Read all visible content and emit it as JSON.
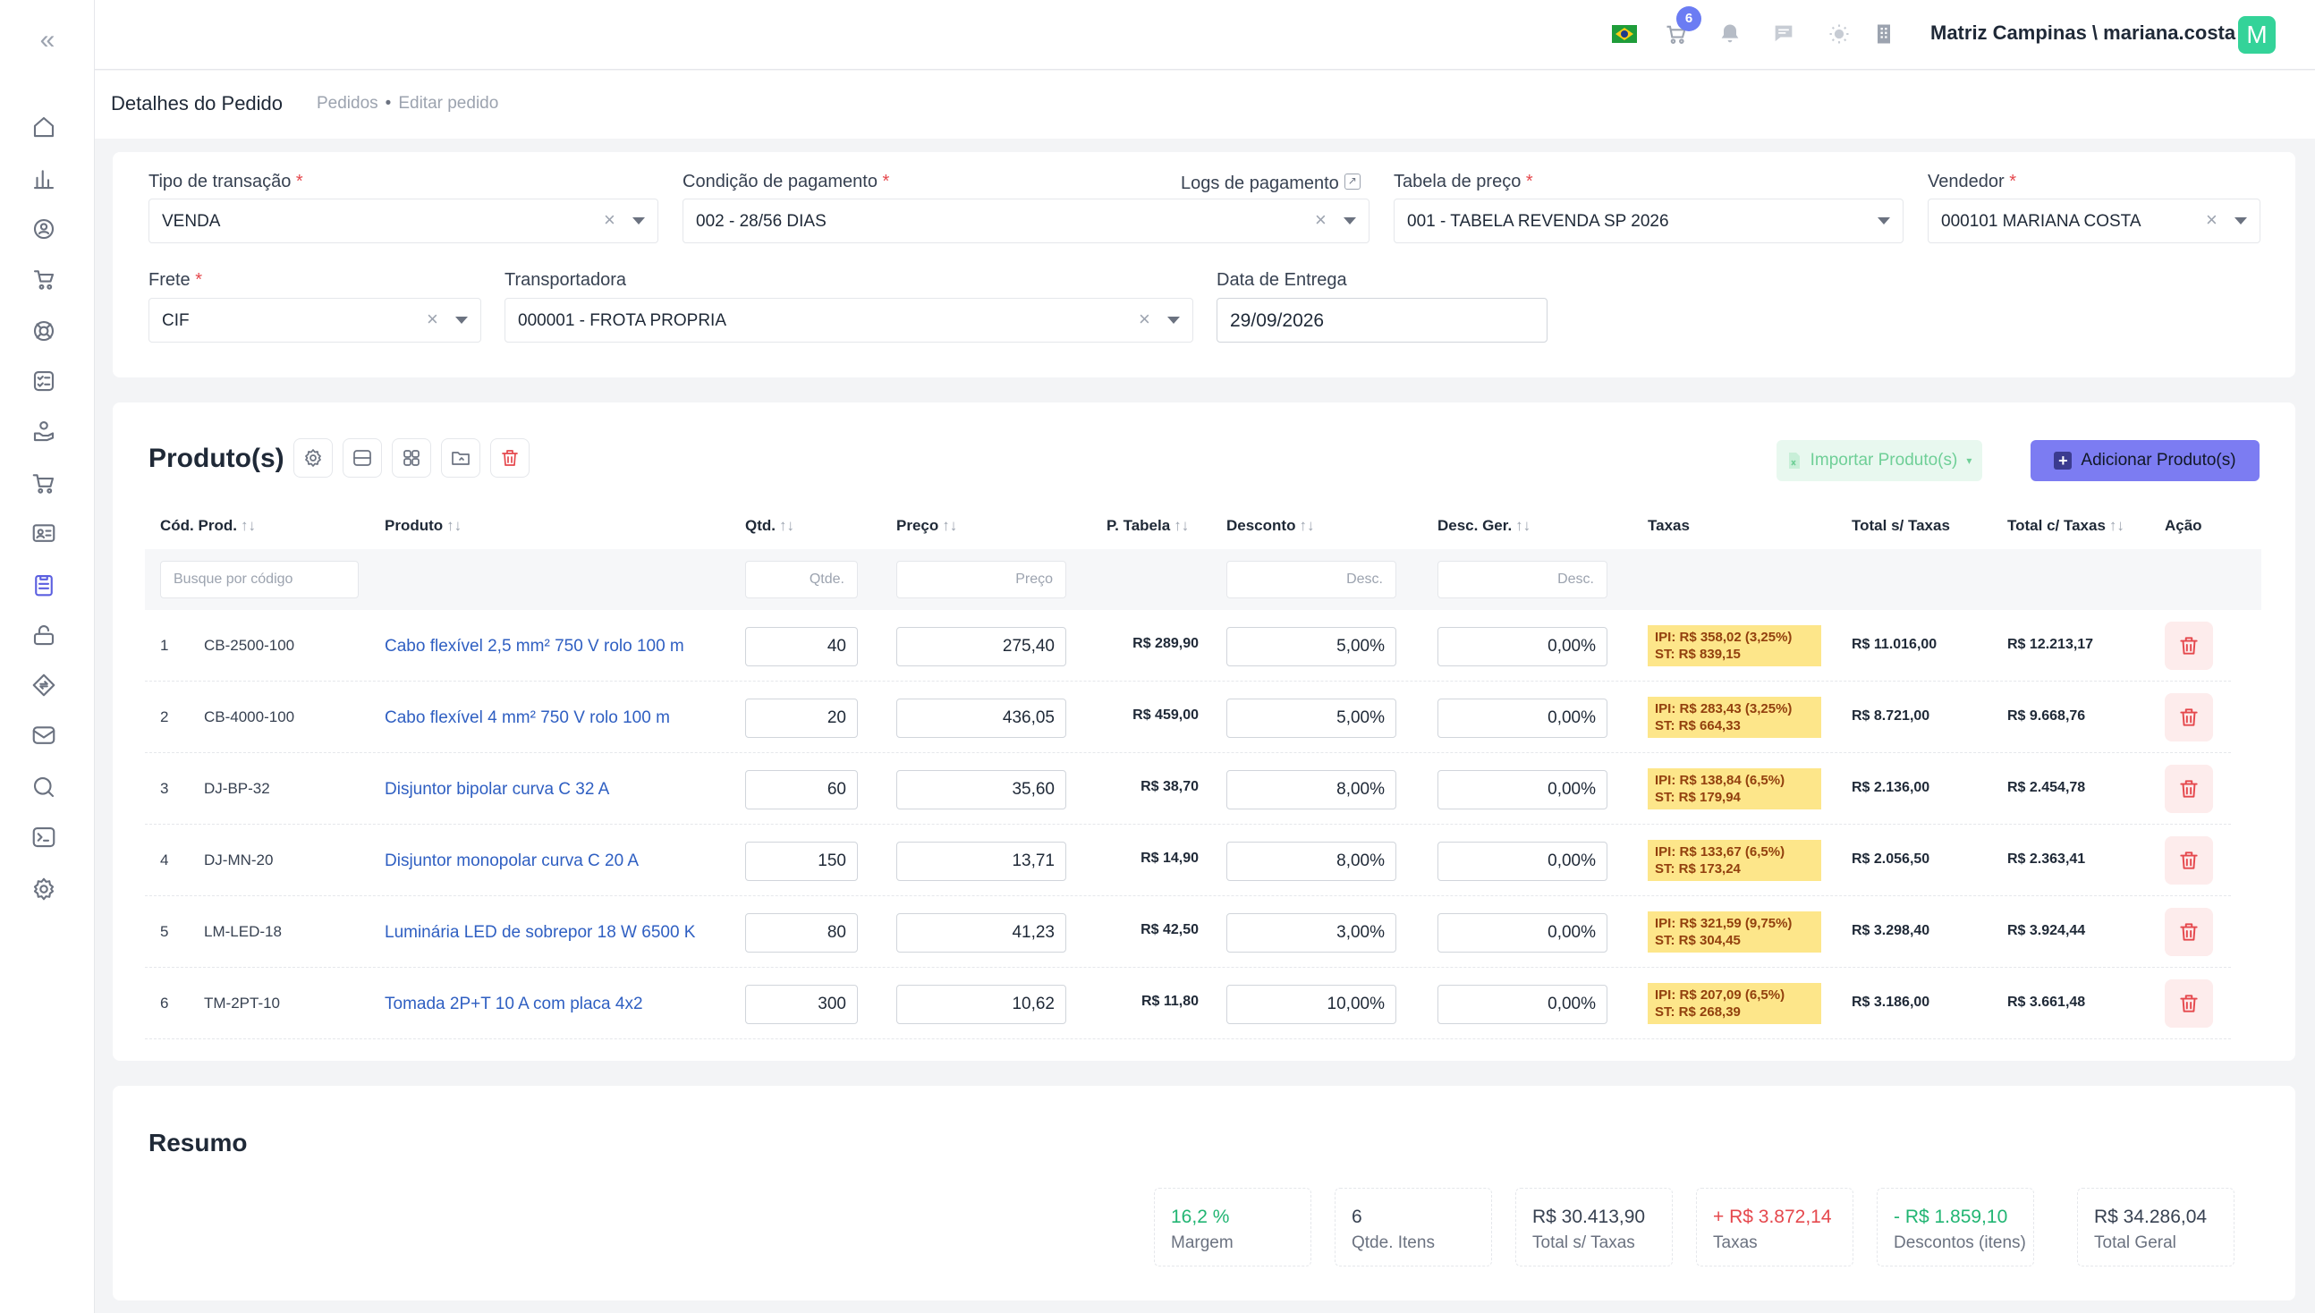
{
  "header": {
    "cart_count": "6",
    "user": "Matriz Campinas \\ mariana.costa",
    "avatar_letter": "M"
  },
  "breadcrumb": {
    "title": "Detalhes do Pedido",
    "items": [
      "Pedidos",
      "Editar pedido"
    ]
  },
  "form": {
    "tipo_label": "Tipo de transação",
    "tipo_value": "VENDA",
    "condicao_label": "Condição de pagamento",
    "condicao_value": "002 - 28/56 DIAS",
    "logs_label": "Logs de pagamento",
    "tabela_label": "Tabela de preço",
    "tabela_value": "001 - TABELA REVENDA SP 2026",
    "vendedor_label": "Vendedor",
    "vendedor_value": "000101 MARIANA COSTA",
    "frete_label": "Frete",
    "frete_value": "CIF",
    "transportadora_label": "Transportadora",
    "transportadora_value": "000001 - FROTA PROPRIA",
    "entrega_label": "Data de Entrega",
    "entrega_value": "29/09/2026",
    "required_mark": "*",
    "clear_glyph": "×"
  },
  "products": {
    "title": "Produto(s)",
    "import_label": "Importar Produto(s)",
    "add_label": "Adicionar Produto(s)",
    "sort_glyph": "↑↓",
    "columns": {
      "codigo": "Cód. Prod.",
      "produto": "Produto",
      "qtd": "Qtd.",
      "preco": "Preço",
      "ptabela": "P. Tabela",
      "desconto": "Desconto",
      "descger": "Desc. Ger.",
      "taxas": "Taxas",
      "total_s": "Total s/ Taxas",
      "total_c": "Total c/ Taxas",
      "acao": "Ação"
    },
    "filters": {
      "codigo": "Busque por código",
      "qtd": "Qtde.",
      "preco": "Preço",
      "desconto": "Desc.",
      "descger": "Desc."
    },
    "rows": [
      {
        "n": "1",
        "code": "CB-2500-100",
        "name": "Cabo flexível 2,5 mm² 750 V rolo 100 m",
        "qtd": "40",
        "preco": "275,40",
        "ptabela": "R$ 289,90",
        "desconto": "5,00%",
        "descger": "0,00%",
        "ipi": "IPI: R$ 358,02 (3,25%)",
        "st": "ST: R$ 839,15",
        "total_s": "R$ 11.016,00",
        "total_c": "R$ 12.213,17"
      },
      {
        "n": "2",
        "code": "CB-4000-100",
        "name": "Cabo flexível 4 mm² 750 V rolo 100 m",
        "qtd": "20",
        "preco": "436,05",
        "ptabela": "R$ 459,00",
        "desconto": "5,00%",
        "descger": "0,00%",
        "ipi": "IPI: R$ 283,43 (3,25%)",
        "st": "ST: R$ 664,33",
        "total_s": "R$ 8.721,00",
        "total_c": "R$ 9.668,76"
      },
      {
        "n": "3",
        "code": "DJ-BP-32",
        "name": "Disjuntor bipolar curva C 32 A",
        "qtd": "60",
        "preco": "35,60",
        "ptabela": "R$ 38,70",
        "desconto": "8,00%",
        "descger": "0,00%",
        "ipi": "IPI: R$ 138,84 (6,5%)",
        "st": "ST: R$ 179,94",
        "total_s": "R$ 2.136,00",
        "total_c": "R$ 2.454,78"
      },
      {
        "n": "4",
        "code": "DJ-MN-20",
        "name": "Disjuntor monopolar curva C 20 A",
        "qtd": "150",
        "preco": "13,71",
        "ptabela": "R$ 14,90",
        "desconto": "8,00%",
        "descger": "0,00%",
        "ipi": "IPI: R$ 133,67 (6,5%)",
        "st": "ST: R$ 173,24",
        "total_s": "R$ 2.056,50",
        "total_c": "R$ 2.363,41"
      },
      {
        "n": "5",
        "code": "LM-LED-18",
        "name": "Luminária LED de sobrepor 18 W 6500 K",
        "qtd": "80",
        "preco": "41,23",
        "ptabela": "R$ 42,50",
        "desconto": "3,00%",
        "descger": "0,00%",
        "ipi": "IPI: R$ 321,59 (9,75%)",
        "st": "ST: R$ 304,45",
        "total_s": "R$ 3.298,40",
        "total_c": "R$ 3.924,44"
      },
      {
        "n": "6",
        "code": "TM-2PT-10",
        "name": "Tomada 2P+T 10 A com placa 4x2",
        "qtd": "300",
        "preco": "10,62",
        "ptabela": "R$ 11,80",
        "desconto": "10,00%",
        "descger": "0,00%",
        "ipi": "IPI: R$ 207,09 (6,5%)",
        "st": "ST: R$ 268,39",
        "total_s": "R$ 3.186,00",
        "total_c": "R$ 3.661,48"
      }
    ]
  },
  "summary": {
    "title": "Resumo",
    "boxes": [
      {
        "value": "16,2 %",
        "label": "Margem",
        "color": "#22b573"
      },
      {
        "value": "6",
        "label": "Qtde. Itens",
        "color": "#374151"
      },
      {
        "value": "R$ 30.413,90",
        "label": "Total s/ Taxas",
        "color": "#374151"
      },
      {
        "value": "+ R$ 3.872,14",
        "label": "Taxas",
        "color": "#e5484d"
      },
      {
        "value": "- R$ 1.859,10",
        "label": "Descontos (itens)",
        "color": "#22b573"
      },
      {
        "value": "R$ 34.286,04",
        "label": "Total Geral",
        "color": "#374151"
      }
    ]
  }
}
